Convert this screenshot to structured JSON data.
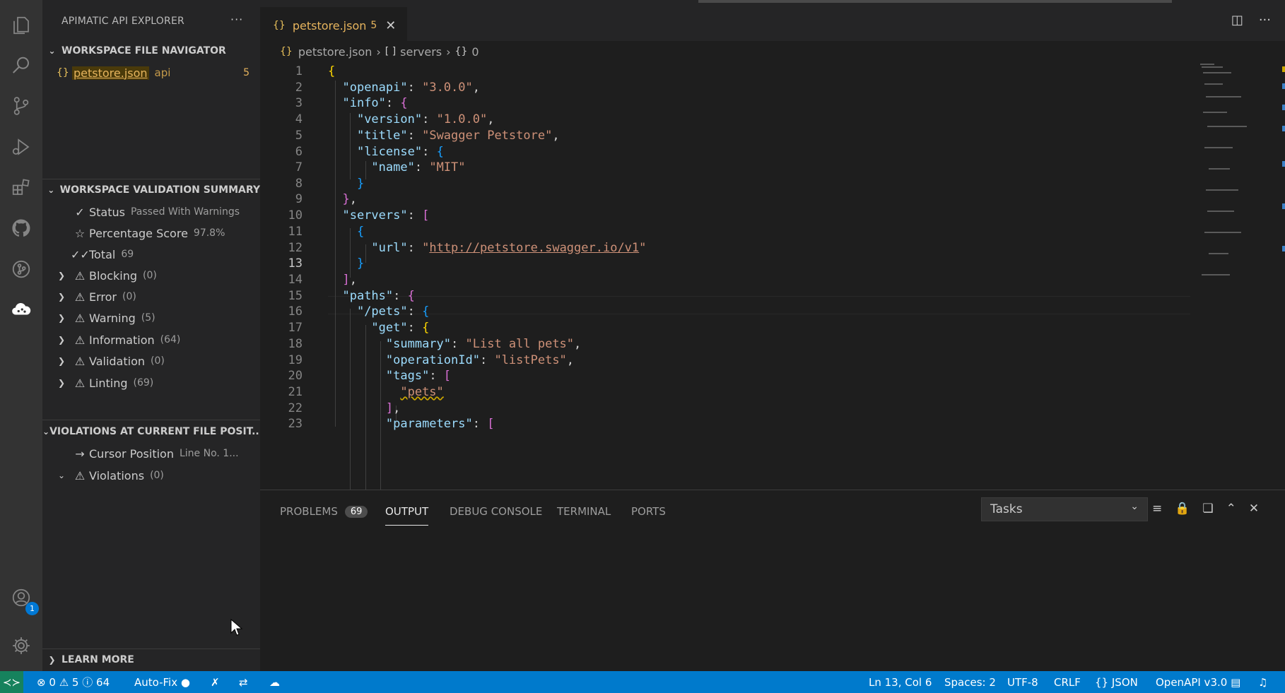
{
  "activity_bar": {
    "items": [
      "explorer-icon",
      "search-icon",
      "source-control-icon",
      "run-debug-icon",
      "extensions-icon",
      "github-icon",
      "git-graph-icon",
      "apimatic-cloud-icon"
    ],
    "accounts_badge": "1"
  },
  "sidebar": {
    "title": "APIMATIC API EXPLORER",
    "more": "···",
    "file_navigator": {
      "header": "WORKSPACE FILE NAVIGATOR",
      "file": {
        "name": "petstore.json",
        "tag": "api",
        "count": "5"
      }
    },
    "validation_summary": {
      "header": "WORKSPACE VALIDATION SUMMARY",
      "status_label": "Status",
      "status_value": "Passed With Warnings",
      "score_label": "Percentage Score",
      "score_value": "97.8%",
      "total_label": "Total",
      "total_value": "69",
      "categories": [
        {
          "label": "Blocking",
          "count": "(0)"
        },
        {
          "label": "Error",
          "count": "(0)"
        },
        {
          "label": "Warning",
          "count": "(5)"
        },
        {
          "label": "Information",
          "count": "(64)"
        },
        {
          "label": "Validation",
          "count": "(0)"
        },
        {
          "label": "Linting",
          "count": "(69)"
        }
      ]
    },
    "violations": {
      "header": "VIOLATIONS AT CURRENT FILE POSIT...",
      "cursor_label": "Cursor Position",
      "cursor_value": "Line No. 1...",
      "violations_label": "Violations",
      "violations_count": "(0)"
    },
    "learn_more": "LEARN MORE"
  },
  "tab": {
    "name": "petstore.json",
    "count": "5"
  },
  "breadcrumb": {
    "file": "petstore.json",
    "seg1_icon": "[ ]",
    "seg1": "servers",
    "seg2_icon": "{}",
    "seg2": "0"
  },
  "editor": {
    "current_line": 13,
    "lines": [
      "1",
      "2",
      "3",
      "4",
      "5",
      "6",
      "7",
      "8",
      "9",
      "10",
      "11",
      "12",
      "13",
      "14",
      "15",
      "16",
      "17",
      "18",
      "19",
      "20",
      "21",
      "22",
      "23"
    ],
    "code": {
      "openapi_key": "\"openapi\"",
      "openapi_val": "\"3.0.0\"",
      "info_key": "\"info\"",
      "version_key": "\"version\"",
      "version_val": "\"1.0.0\"",
      "title_key": "\"title\"",
      "title_val": "\"Swagger Petstore\"",
      "license_key": "\"license\"",
      "name_key": "\"name\"",
      "name_val": "\"MIT\"",
      "servers_key": "\"servers\"",
      "url_key": "\"url\"",
      "url_val": "http://petstore.swagger.io/v1",
      "paths_key": "\"paths\"",
      "pets_path_key": "\"/pets\"",
      "get_key": "\"get\"",
      "summary_key": "\"summary\"",
      "summary_val": "\"List all pets\"",
      "opid_key": "\"operationId\"",
      "opid_val": "\"listPets\"",
      "tags_key": "\"tags\"",
      "pets_val": "\"pets\"",
      "parameters_key": "\"parameters\""
    }
  },
  "panel": {
    "tabs": [
      "PROBLEMS",
      "OUTPUT",
      "DEBUG CONSOLE",
      "TERMINAL",
      "PORTS"
    ],
    "problems_count": "69",
    "active_tab": "OUTPUT",
    "output_channel": "Tasks"
  },
  "statusbar": {
    "errors": "0",
    "warnings": "5",
    "infos": "64",
    "autofix": "Auto-Fix",
    "position": "Ln 13, Col 6",
    "spaces": "Spaces: 2",
    "encoding": "UTF-8",
    "eol": "CRLF",
    "language": "JSON",
    "openapi": "OpenAPI v3.0"
  },
  "colors": {
    "status_bar": "#007acc",
    "remote": "#16825d",
    "warning_file": "#e6b45d"
  }
}
